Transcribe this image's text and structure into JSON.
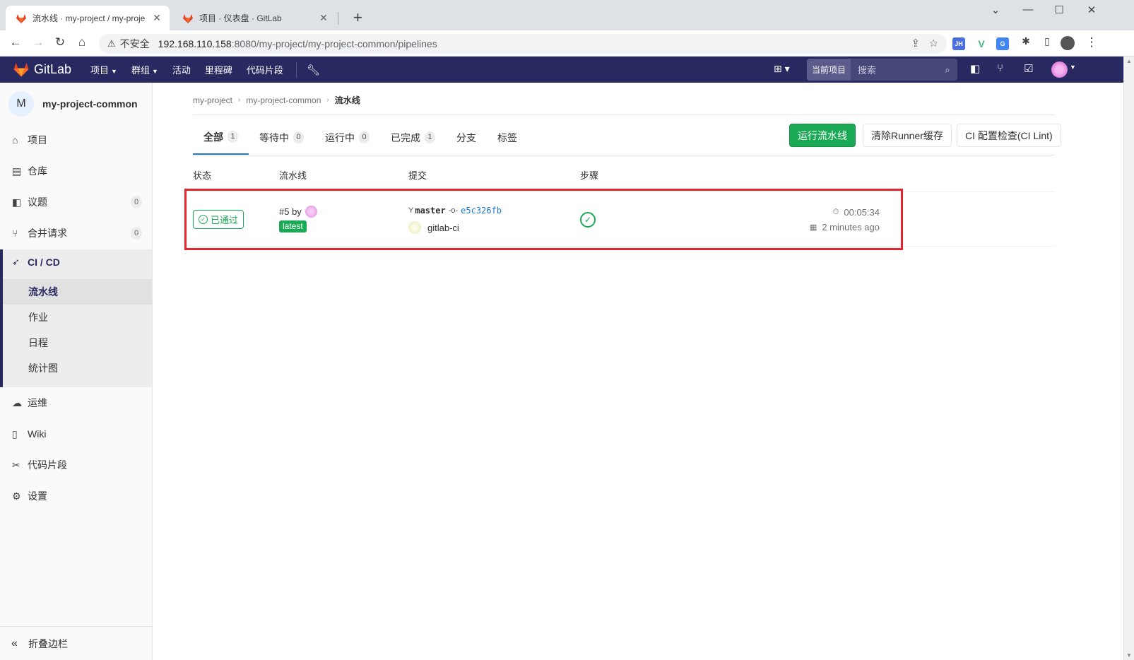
{
  "browser": {
    "tabs": [
      {
        "title": "流水线 · my-project / my-proje",
        "active": true
      },
      {
        "title": "项目 · 仪表盘 · GitLab",
        "active": false
      }
    ],
    "new_tab": "+",
    "window_controls": {
      "dropdown": "⌄",
      "minimize": "—",
      "maximize": "☐",
      "close": "✕"
    },
    "nav": {
      "back": "←",
      "forward": "→",
      "reload": "↻",
      "home": "⌂"
    },
    "security_label": "不安全",
    "url_host": "192.168.110.158",
    "url_path": ":8080/my-project/my-project-common/pipelines",
    "extensions": [
      {
        "label": "JH",
        "color": "#4a6ee0"
      },
      {
        "label": "V",
        "color": "#42b883"
      },
      {
        "label": "G",
        "color": "#4285f4"
      }
    ]
  },
  "gitlab_header": {
    "logo_text": "GitLab",
    "nav": [
      "项目",
      "群组",
      "活动",
      "里程碑",
      "代码片段"
    ],
    "search_scope": "当前项目",
    "search_placeholder": "搜索"
  },
  "sidebar": {
    "project_initial": "M",
    "project_name": "my-project-common",
    "items": [
      {
        "label": "项目",
        "icon": "home-icon"
      },
      {
        "label": "仓库",
        "icon": "book-icon"
      },
      {
        "label": "议题",
        "icon": "issues-icon",
        "badge": "0"
      },
      {
        "label": "合并请求",
        "icon": "merge-request-icon",
        "badge": "0"
      }
    ],
    "cicd": {
      "label": "CI / CD",
      "subitems": [
        "流水线",
        "作业",
        "日程",
        "统计图"
      ]
    },
    "items_after": [
      {
        "label": "运维",
        "icon": "cloud-gear-icon"
      },
      {
        "label": "Wiki",
        "icon": "wiki-book-icon"
      },
      {
        "label": "代码片段",
        "icon": "scissors-icon"
      },
      {
        "label": "设置",
        "icon": "gear-icon"
      }
    ],
    "collapse_label": "折叠边栏"
  },
  "breadcrumb": [
    "my-project",
    "my-project-common",
    "流水线"
  ],
  "tabs": [
    {
      "label": "全部",
      "count": "1"
    },
    {
      "label": "等待中",
      "count": "0"
    },
    {
      "label": "运行中",
      "count": "0"
    },
    {
      "label": "已完成",
      "count": "1"
    },
    {
      "label": "分支"
    },
    {
      "label": "标签"
    }
  ],
  "buttons": {
    "run_pipeline": "运行流水线",
    "clear_cache": "清除Runner缓存",
    "ci_lint": "CI 配置检查(CI Lint)"
  },
  "table": {
    "headers": [
      "状态",
      "流水线",
      "提交",
      "步骤"
    ],
    "rows": [
      {
        "status": "已通过",
        "pipeline_id": "#5 by",
        "tag": "latest",
        "branch": "master",
        "sha": "e5c326fb",
        "commit_message": "gitlab-ci",
        "duration": "00:05:34",
        "finished": "2 minutes ago"
      }
    ]
  },
  "colors": {
    "header_bg": "#292961",
    "success": "#1aaa55",
    "link": "#1f78d1",
    "highlight_box": "#e5242b"
  }
}
